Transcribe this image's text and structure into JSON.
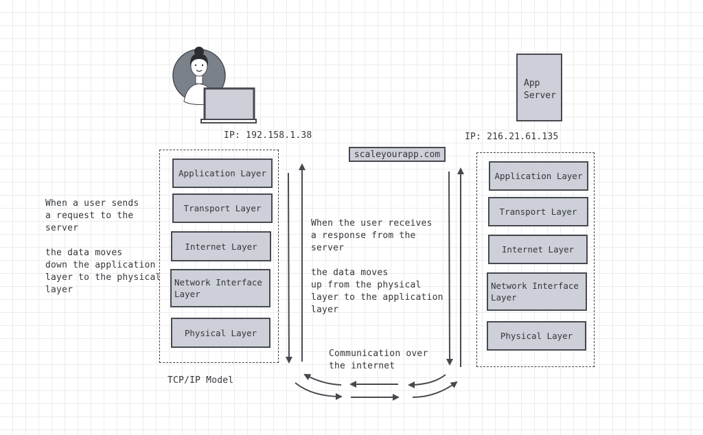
{
  "client": {
    "icon": "user-with-laptop-icon",
    "ip_label": "IP: 192.158.1.38"
  },
  "server": {
    "label": "App\nServer",
    "ip_label": "IP: 216.21.61.135"
  },
  "domain": {
    "label": "scaleyourapp.com"
  },
  "left_stack": {
    "layers": [
      {
        "label": "Application Layer"
      },
      {
        "label": "Transport Layer"
      },
      {
        "label": "Internet Layer"
      },
      {
        "label": "Network Interface\nLayer"
      },
      {
        "label": "Physical Layer"
      }
    ],
    "caption": "TCP/IP Model"
  },
  "right_stack": {
    "layers": [
      {
        "label": "Application Layer"
      },
      {
        "label": "Transport Layer"
      },
      {
        "label": "Internet Layer"
      },
      {
        "label": "Network Interface\nLayer"
      },
      {
        "label": "Physical Layer"
      }
    ]
  },
  "notes": {
    "send": "When a user sends\na request to the\nserver\n\nthe data moves\ndown the application\nlayer to the physical\nlayer",
    "receive": "When the user receives\na response from the\nserver\n\nthe data moves\nup from the physical\nlayer to the application\nlayer",
    "internet": "Communication over\nthe internet"
  },
  "colors": {
    "stroke": "#45484e",
    "fill": "#cdd0d8",
    "avatar_bg": "#7b8189",
    "grid": "#ececec"
  }
}
